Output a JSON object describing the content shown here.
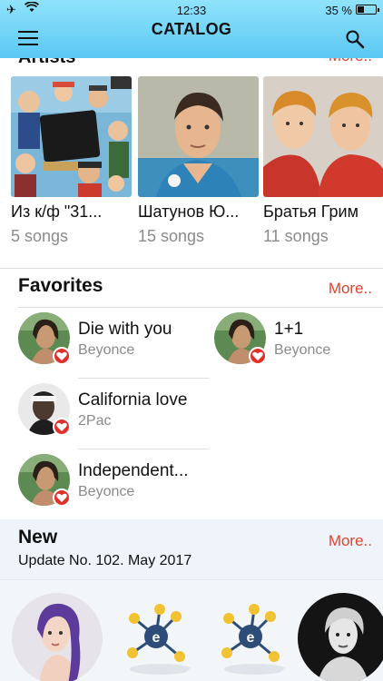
{
  "status": {
    "time": "12:33",
    "battery": "35 %"
  },
  "header": {
    "title": "CATALOG"
  },
  "artists": {
    "title": "Artists",
    "more": "More..",
    "items": [
      {
        "name": "Из к/ф \"31...",
        "count": "5 songs"
      },
      {
        "name": "Шатунов Ю...",
        "count": "15 songs"
      },
      {
        "name": "Братья Грим",
        "count": "11 songs"
      }
    ]
  },
  "favorites": {
    "title": "Favorites",
    "more": "More..",
    "items": [
      {
        "song": "Die with you",
        "artist": "Beyonce"
      },
      {
        "song": "1+1",
        "artist": "Beyonce"
      },
      {
        "song": "California love",
        "artist": "2Pac"
      },
      {
        "song": "Independent...",
        "artist": "Beyonce"
      }
    ]
  },
  "new": {
    "title": "New",
    "subtitle": "Update No. 102. May 2017",
    "more": "More.."
  },
  "colors": {
    "accent": "#e0442a",
    "header_top": "#8fe3fb",
    "header_bottom": "#5bc8f4"
  }
}
